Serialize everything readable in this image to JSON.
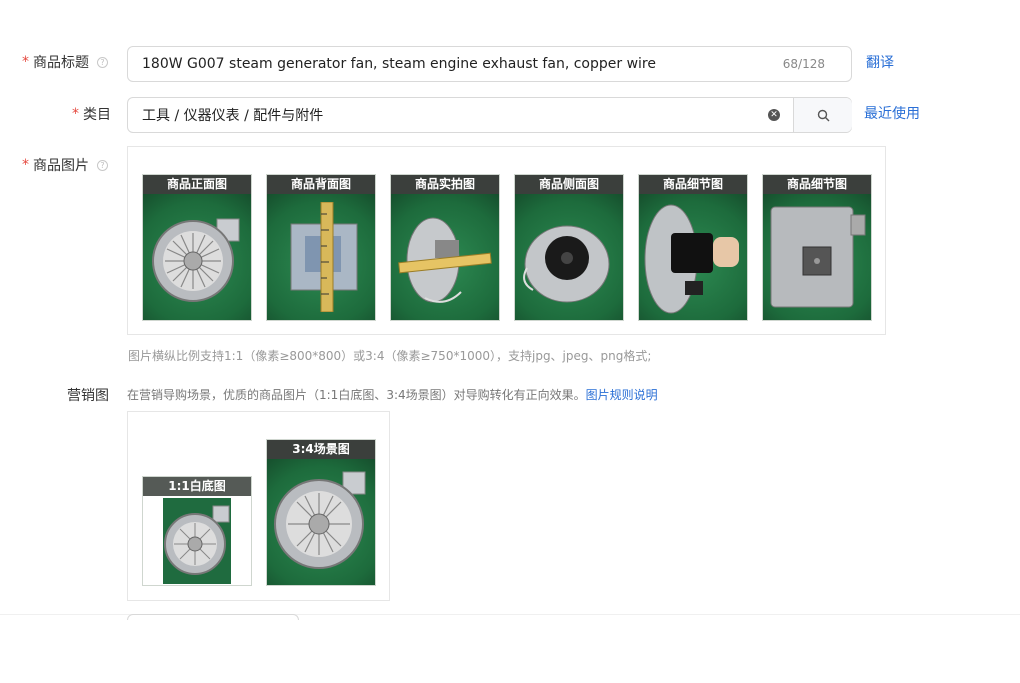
{
  "title_field": {
    "label": "商品标题",
    "value": "180W G007 steam generator fan, steam engine exhaust fan, copper wire",
    "counter": "68/128",
    "translate_link": "翻译"
  },
  "category_field": {
    "label": "类目",
    "value": "工具 / 仪器仪表 / 配件与附件",
    "recent_link": "最近使用"
  },
  "images_field": {
    "label": "商品图片",
    "thumbnails": [
      {
        "caption": "商品正面图",
        "icon": "blower-fan-front"
      },
      {
        "caption": "商品背面图",
        "icon": "blower-back-with-tape"
      },
      {
        "caption": "商品实拍图",
        "icon": "blower-side-measure"
      },
      {
        "caption": "商品侧面图",
        "icon": "blower-motor-side"
      },
      {
        "caption": "商品细节图",
        "icon": "motor-detail"
      },
      {
        "caption": "商品细节图",
        "icon": "blower-back-plate"
      }
    ],
    "hint": "图片横纵比例支持1:1（像素≥800*800）或3:4（像素≥750*1000），支持jpg、jpeg、png格式;"
  },
  "marketing_field": {
    "label": "营销图",
    "description": "在营销导购场景，优质的商品图片（1:1白底图、3:4场景图）对导购转化有正向效果。",
    "rules_link": "图片规则说明",
    "images": [
      {
        "caption": "1:1白底图"
      },
      {
        "caption": "3:4场景图"
      }
    ]
  },
  "colors": {
    "required_star": "#e5483e",
    "link": "#2a6fd6",
    "thumb_bg": "#1f6b3f"
  }
}
